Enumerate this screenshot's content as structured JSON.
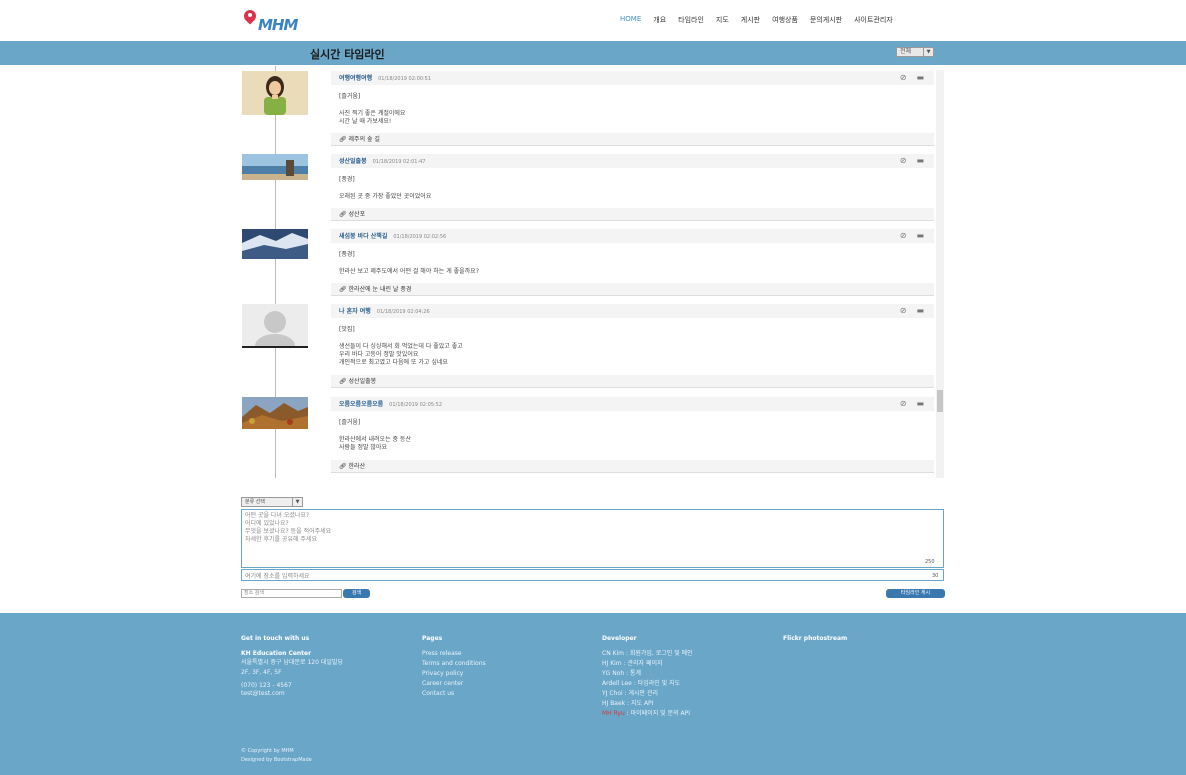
{
  "header": {
    "logo_text": "MHM",
    "nav": [
      "HOME",
      "개요",
      "타임라인",
      "지도",
      "게시판",
      "여행상품",
      "문의게시판",
      "사이트관리자"
    ]
  },
  "titlebar": {
    "title": "실시간 타임라인",
    "filter_value": "전체"
  },
  "posts": [
    {
      "author": "여행여행여행",
      "date": "01/18/2019 02:00:51",
      "tag": "[즐거움]",
      "body": "사진 찍기 좋은 계절이에요\n시간 날 때 가보세요!",
      "place": "제주의 숲 길"
    },
    {
      "author": "성산일출봉",
      "date": "01/18/2019 02:01:47",
      "tag": "[풍경]",
      "body": "오래된 곳 중 가장 좋았던 곳이었어요",
      "place": "성산포"
    },
    {
      "author": "새섬봉 바다 산책길",
      "date": "01/18/2019 02:02:56",
      "tag": "[풍경]",
      "body": "한라산 보고 제주도에서 어떤 걸 해야 하는 게 좋을까요?",
      "place": "한라산에 눈 내린 날 풍경"
    },
    {
      "author": "나 혼자 여행",
      "date": "01/18/2019 02:04:26",
      "tag": "[맛집]",
      "body": "생선들이 다 싱싱해서 회 먹었는데 다 좋았고 좋고\n우리 바다 고등어 정말 맛있어요\n개인적으로 최고였고 다음에 또 가고 싶네요",
      "place": "성산일출봉"
    },
    {
      "author": "오름오름오름오름",
      "date": "01/18/2019 02:05:52",
      "tag": "[즐거움]",
      "body": "한라산에서 내려오는 중 등산\n사람들 정말 많아요",
      "place": "한라산"
    }
  ],
  "form": {
    "category": "분류 선택",
    "content_placeholder": "어떤 곳을 다녀 오셨나요?\n어디에 있었나요?\n무엇을 보셨나요? 등을 적어주세요\n자세한 후기를 공유해 주세요",
    "content_count": "250",
    "place_placeholder": "여기에 장소를 입력하세요",
    "place_count": "30",
    "search_placeholder": "장소 검색",
    "search_btn": "검색",
    "submit_btn": "타임라인 게시"
  },
  "footer": {
    "col1": {
      "head": "Get in touch with us",
      "org": "KH Education Center",
      "address": "서울특별시 중구 남대문로 120 대일빌딩\n2F, 3F, 4F, 5F",
      "phone": "(070) 123 - 4567",
      "email": "test@test.com"
    },
    "col2": {
      "head": "Pages",
      "links": [
        "Press release",
        "Terms and conditions",
        "Privacy policy",
        "Career center",
        "Contact us"
      ]
    },
    "col3": {
      "head": "Developer",
      "devs": [
        {
          "name": "CN Kim",
          "role": "회원가입, 로그인 및 메인"
        },
        {
          "name": "HJ Kim",
          "role": "관리자 페이지"
        },
        {
          "name": "YG Noh",
          "role": "통계"
        },
        {
          "name": "Ardell Lee",
          "role": "타임라인 및 지도"
        },
        {
          "name": "YJ Choi",
          "role": "게시판 관리"
        },
        {
          "name": "HJ Baek",
          "role": "지도 API"
        },
        {
          "name": "MH Ryu",
          "role": "마이페이지 및 문의 API"
        }
      ]
    },
    "col4": {
      "head": "Flickr photostream"
    },
    "copyright": "© Copyright by MHM",
    "designed": "Designed by BootstrapMade"
  },
  "colors": {
    "accent": "#6aa6c8",
    "link": "#2a5f8f",
    "button": "#3a78b0",
    "highlight": "#d63a3a"
  }
}
